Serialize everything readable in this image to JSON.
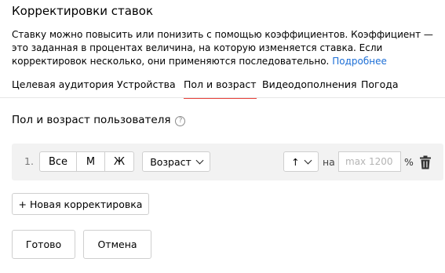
{
  "header": {
    "title": "Корректировки ставок",
    "description": "Ставку можно повысить или понизить с помощью коэффициентов. Коэффициент — это заданная в процентах величина, на которую изменяется ставка. Если корректировок несколько, они применяются последовательно.",
    "more_link": "Подробнее"
  },
  "tabs": [
    {
      "label": "Целевая аудитория"
    },
    {
      "label": "Устройства"
    },
    {
      "label": "Пол и возраст"
    },
    {
      "label": "Видеодополнения"
    },
    {
      "label": "Погода"
    }
  ],
  "active_tab": "Пол и возраст",
  "section": {
    "title": "Пол и возраст пользователя",
    "help_icon": "question-circle-icon"
  },
  "row": {
    "number": "1.",
    "gender_options": [
      {
        "label": "Все"
      },
      {
        "label": "М"
      },
      {
        "label": "Ж"
      }
    ],
    "age_label": "Возраст",
    "direction_label": "↑",
    "na_label": "на",
    "value_placeholder": "max 1200",
    "unit": "%",
    "delete_icon": "trash-icon"
  },
  "add_button": "+ Новая корректировка",
  "actions": {
    "done": "Готово",
    "cancel": "Отмена"
  },
  "colors": {
    "accent": "#e8413a",
    "link": "#1d6fd6",
    "panel": "#f2f2f2"
  }
}
